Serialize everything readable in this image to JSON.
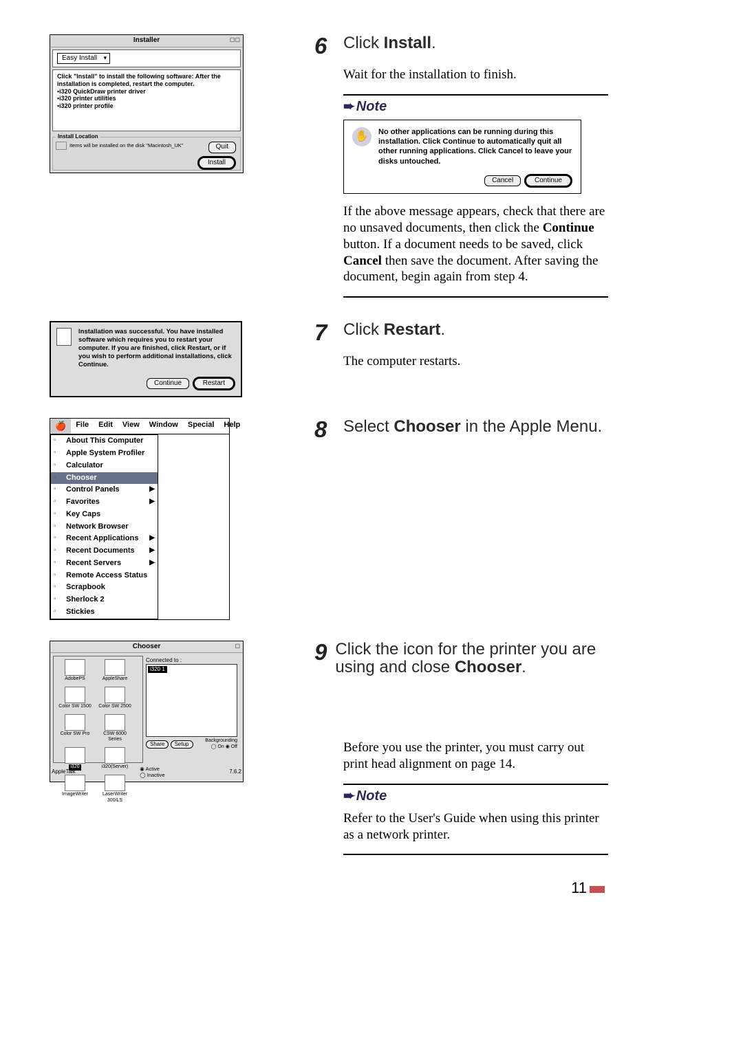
{
  "steps": {
    "s6": {
      "num": "6",
      "title_pre": "Click ",
      "title_b": "Install",
      "title_post": ".",
      "body": "Wait for the installation to finish."
    },
    "s7": {
      "num": "7",
      "title_pre": "Click ",
      "title_b": "Restart",
      "title_post": ".",
      "body": "The computer restarts."
    },
    "s8": {
      "num": "8",
      "title_pre": "Select ",
      "title_b": "Chooser",
      "title_post": " in the Apple Menu."
    },
    "s9": {
      "num": "9",
      "title_pre": "Click the icon for the printer you are using and close ",
      "title_b": "Chooser",
      "title_post": ".",
      "body": "Before you use the printer, you must carry out print head alignment on page 14."
    }
  },
  "note_label": "Note",
  "installer": {
    "title": "Installer",
    "mode": "Easy Install",
    "instruction": "Click \"Install\" to install the following software: After the installation is completed, restart the computer.",
    "items": [
      "•i320 QuickDraw printer driver",
      "•i320 printer utilities",
      "•i320 printer profile"
    ],
    "location_label": "Install Location",
    "location_text": "Items will be installed on the disk \"Macintosh_UK\"",
    "quit": "Quit",
    "install": "Install"
  },
  "warning_dialog": {
    "text": "No other applications can be running during this installation. Click Continue to automatically quit all other running applications. Click Cancel to leave your disks untouched.",
    "cancel": "Cancel",
    "continue": "Continue"
  },
  "after_warning": {
    "p1": "If the above message appears, check that there are no unsaved documents, then click the ",
    "b1": "Continue",
    "p2": " button. If a document needs to be saved, click ",
    "b2": "Cancel",
    "p3": " then save the document. After saving the document, begin again from step 4."
  },
  "success_dialog": {
    "text": "Installation was successful. You have installed software which requires you to restart your computer. If you are finished, click Restart, or if you wish to perform additional installations, click Continue.",
    "continue": "Continue",
    "restart": "Restart"
  },
  "menubar": {
    "items": [
      "File",
      "Edit",
      "View",
      "Window",
      "Special",
      "Help"
    ]
  },
  "apple_menu": {
    "items": [
      {
        "label": "About This Computer"
      },
      {
        "label": "Apple System Profiler"
      },
      {
        "label": "Calculator"
      },
      {
        "label": "Chooser",
        "selected": true
      },
      {
        "label": "Control Panels",
        "sub": true
      },
      {
        "label": "Favorites",
        "sub": true
      },
      {
        "label": "Key Caps"
      },
      {
        "label": "Network Browser"
      },
      {
        "label": "Recent Applications",
        "sub": true
      },
      {
        "label": "Recent Documents",
        "sub": true
      },
      {
        "label": "Recent Servers",
        "sub": true
      },
      {
        "label": "Remote Access Status"
      },
      {
        "label": "Scrapbook"
      },
      {
        "label": "Sherlock 2"
      },
      {
        "label": "Stickies"
      }
    ]
  },
  "chooser": {
    "title": "Chooser",
    "connected": "Connected to :",
    "list_item": "i320 1",
    "icons": [
      "AdobePS",
      "AppleShare",
      "Color SW 1500",
      "Color SW 2500",
      "Color SW Pro",
      "CSW 6000 Series",
      "i320",
      "i320(Server)",
      "ImageWriter",
      "LaserWriter 300/LS"
    ],
    "selected_icon": "i320",
    "share": "Share",
    "setup": "Setup",
    "bg_label": "Backgrounding",
    "on": "On",
    "off": "Off",
    "appletalk": "AppleTalk",
    "active": "Active",
    "inactive": "Inactive",
    "ver": "7.6.2"
  },
  "note2": "Refer to the User's Guide when using this printer as a network printer.",
  "page": "11"
}
